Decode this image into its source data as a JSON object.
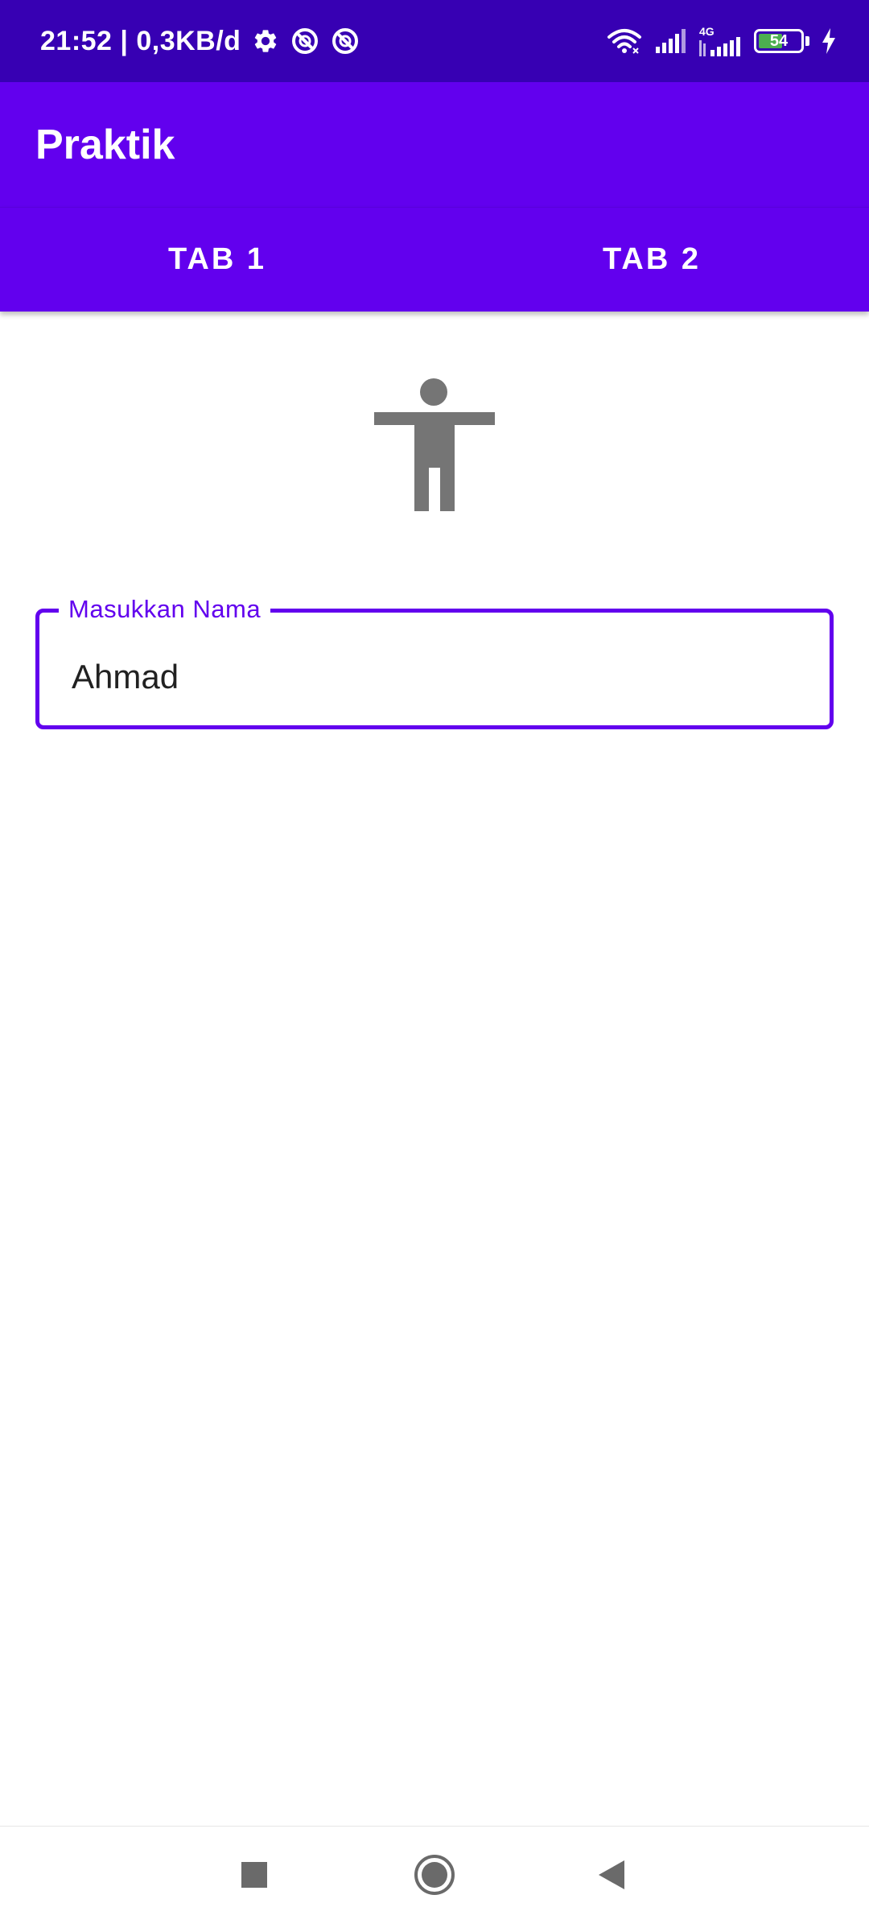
{
  "status_bar": {
    "time_and_speed": "21:52 | 0,3KB/d",
    "network_type": "4G",
    "battery_level": "54",
    "icons": [
      "gear-icon",
      "no-disturb-icon",
      "no-disturb-icon",
      "wifi-icon",
      "signal-icon",
      "signal-4g-icon",
      "battery-icon",
      "charging-icon"
    ]
  },
  "app_bar": {
    "title": "Praktik"
  },
  "tabs": [
    {
      "label": "TAB 1"
    },
    {
      "label": "TAB 2"
    }
  ],
  "main": {
    "illustration_icon": "accessibility-figure-icon",
    "name_field": {
      "label": "Masukkan Nama",
      "value": "Ahmad"
    }
  },
  "nav_bar": {
    "icons": [
      "recents-square-icon",
      "home-circle-icon",
      "back-triangle-icon"
    ]
  },
  "colors": {
    "status_bar": "#3700b3",
    "primary": "#6200ee",
    "icon_gray": "#757575",
    "battery_green": "#4caf50"
  }
}
